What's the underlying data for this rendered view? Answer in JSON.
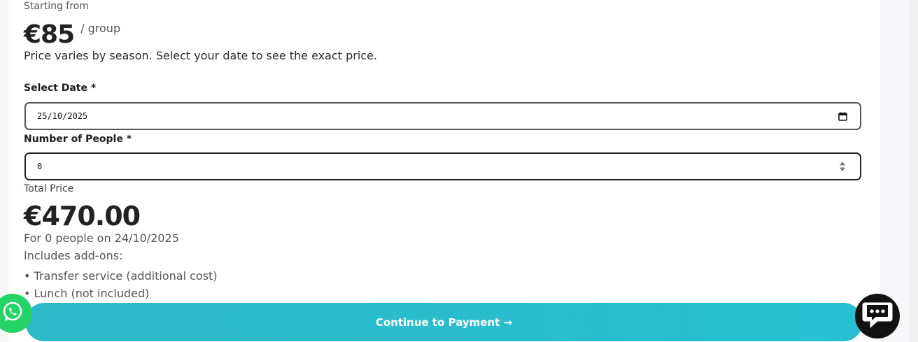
{
  "header": {
    "starting_label": "Starting from",
    "price": "€85",
    "price_unit": "/ group",
    "season_note": "Price varies by season. Select your date to see the exact price."
  },
  "form": {
    "date_label": "Select Date *",
    "date_value": "25/10/2025",
    "people_label": "Number of People *",
    "people_value": "0"
  },
  "summary": {
    "total_label": "Total Price",
    "total_price": "€470.00",
    "for_line": "For 0 people on 24/10/2025",
    "addons_title": "Includes add-ons:",
    "addons": [
      "• Transfer service (additional cost)",
      "• Lunch (not included)"
    ]
  },
  "cta": {
    "label": "Continue to Payment →"
  },
  "widgets": {
    "whatsapp_icon": "whatsapp-icon",
    "chat_icon": "chat-icon"
  },
  "colors": {
    "cta": "#27c0d2",
    "whatsapp": "#25d366"
  }
}
